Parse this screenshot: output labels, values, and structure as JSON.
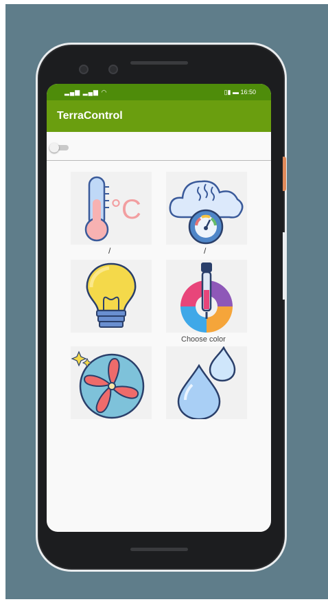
{
  "status_bar": {
    "signal": "▂▄▆ ▂▄▆ ◠",
    "right": "▯▮ ▬ 16:50"
  },
  "app_title": "TerraControl",
  "tiles": [
    {
      "name": "thermometer",
      "sub": "/"
    },
    {
      "name": "weather-gauge",
      "sub": "/"
    },
    {
      "name": "light-bulb",
      "sub": "Choose color"
    },
    {
      "name": "color-picker"
    },
    {
      "name": "fan"
    },
    {
      "name": "humidity"
    }
  ],
  "colors": {
    "status_bar": "#4e8c0a",
    "app_bar": "#6a9e0f",
    "background": "#5f7d8a"
  }
}
